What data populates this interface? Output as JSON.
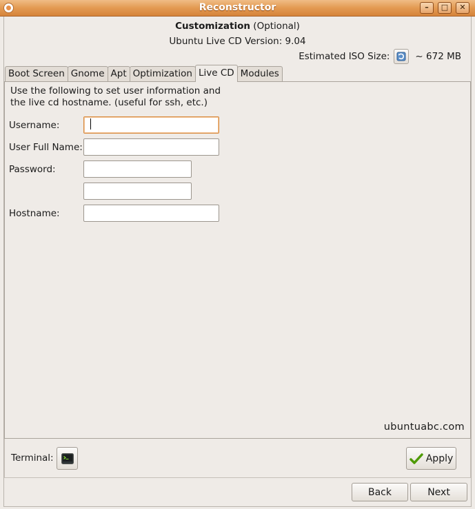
{
  "window": {
    "title": "Reconstructor"
  },
  "header": {
    "heading": "Customization",
    "heading_suffix": "(Optional)",
    "version": "Ubuntu Live CD Version: 9.04",
    "iso_label": "Estimated ISO Size:",
    "iso_value": "~ 672 MB"
  },
  "tabs": [
    {
      "label": "Boot Screen"
    },
    {
      "label": "Gnome"
    },
    {
      "label": "Apt"
    },
    {
      "label": "Optimization"
    },
    {
      "label": "Live CD",
      "active": true
    },
    {
      "label": "Modules"
    }
  ],
  "livecd": {
    "description_line1": "Use the following to set user information and",
    "description_line2": "the live cd hostname. (useful for ssh, etc.)",
    "username_label": "Username:",
    "fullname_label": "User Full Name:",
    "password_label": "Password:",
    "hostname_label": "Hostname:",
    "username_value": "",
    "fullname_value": "",
    "password_value": "",
    "password_confirm_value": "",
    "hostname_value": "",
    "watermark": "ubuntuabc.com"
  },
  "footer": {
    "terminal_label": "Terminal:",
    "apply_label": "Apply",
    "back_label": "Back",
    "next_label": "Next"
  },
  "colors": {
    "titlebar": "#e39a52",
    "background": "#efebe7",
    "focus_border": "#d88a3e",
    "apply_check": "#4e9a06"
  }
}
